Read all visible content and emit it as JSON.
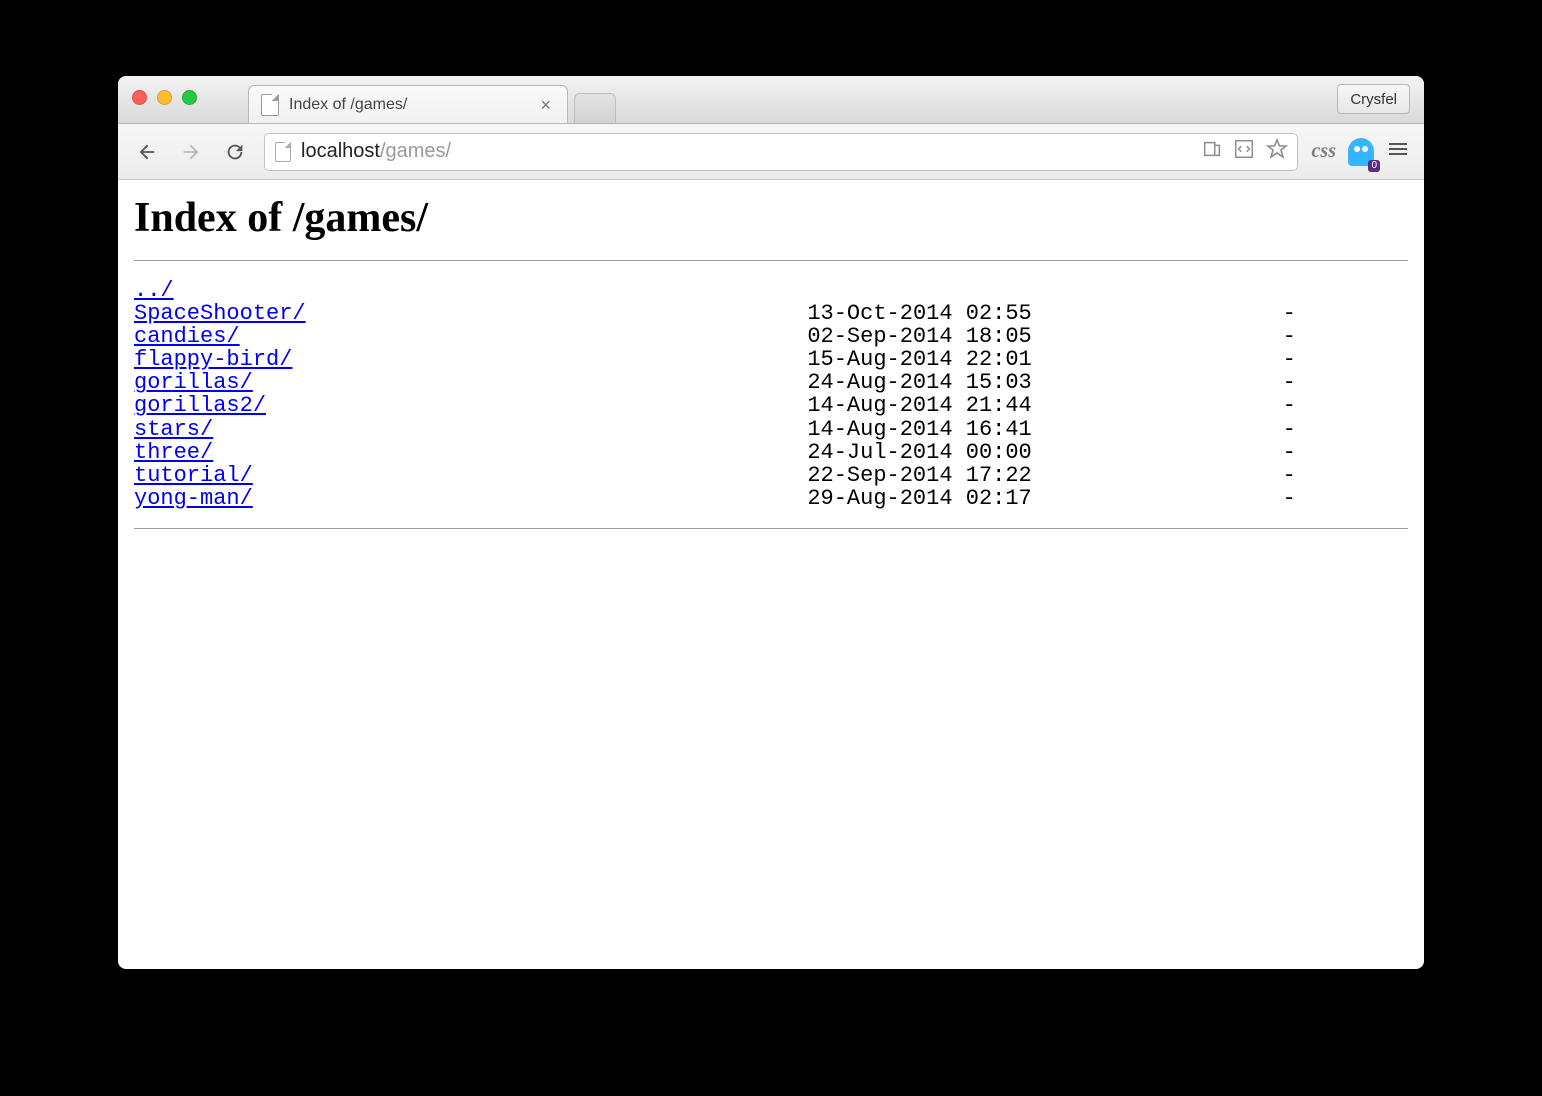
{
  "window": {
    "profile_label": "Crysfel"
  },
  "tab": {
    "title": "Index of /games/"
  },
  "nav": {
    "url_host": "localhost",
    "url_path": "/games/"
  },
  "ghost_badge": "0",
  "page": {
    "heading": "Index of /games/",
    "name_col_width": 51,
    "entries": [
      {
        "name": "../",
        "date": "",
        "size": ""
      },
      {
        "name": "SpaceShooter/",
        "date": "13-Oct-2014 02:55",
        "size": "-"
      },
      {
        "name": "candies/",
        "date": "02-Sep-2014 18:05",
        "size": "-"
      },
      {
        "name": "flappy-bird/",
        "date": "15-Aug-2014 22:01",
        "size": "-"
      },
      {
        "name": "gorillas/",
        "date": "24-Aug-2014 15:03",
        "size": "-"
      },
      {
        "name": "gorillas2/",
        "date": "14-Aug-2014 21:44",
        "size": "-"
      },
      {
        "name": "stars/",
        "date": "14-Aug-2014 16:41",
        "size": "-"
      },
      {
        "name": "three/",
        "date": "24-Jul-2014 00:00",
        "size": "-"
      },
      {
        "name": "tutorial/",
        "date": "22-Sep-2014 17:22",
        "size": "-"
      },
      {
        "name": "yong-man/",
        "date": "29-Aug-2014 02:17",
        "size": "-"
      }
    ]
  }
}
